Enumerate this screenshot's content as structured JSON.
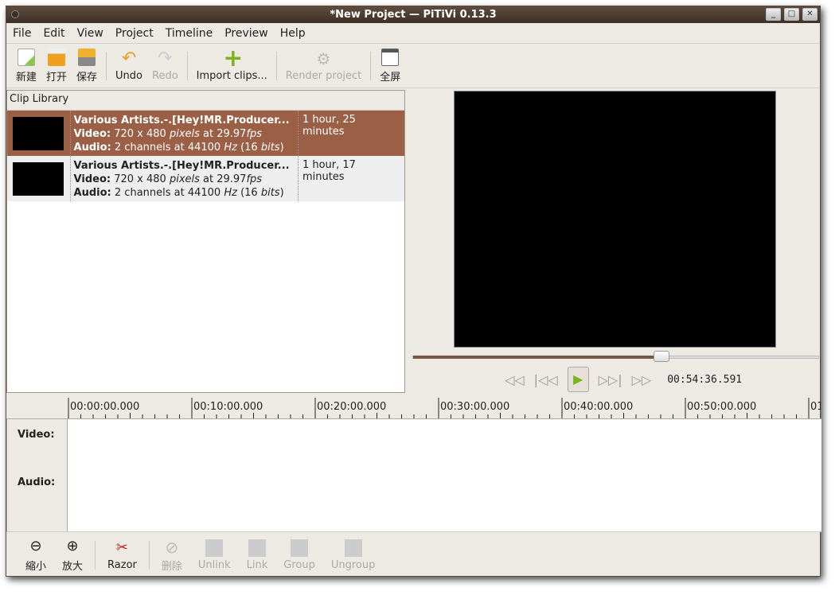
{
  "window": {
    "title": "*New Project — PiTiVi 0.13.3"
  },
  "menu": [
    "File",
    "Edit",
    "View",
    "Project",
    "Timeline",
    "Preview",
    "Help"
  ],
  "toolbar": {
    "new": "新建",
    "open": "打开",
    "save": "保存",
    "undo": "Undo",
    "redo": "Redo",
    "import": "Import clips...",
    "render": "Render project",
    "fullscreen": "全屏"
  },
  "library": {
    "title": "Clip Library",
    "clips": [
      {
        "name": "Various Artists.-.[Hey!MR.Producer...",
        "video_label": "Video:",
        "video": " 720 x 480 ",
        "pixels": "pixels",
        "at": " at 29.97",
        "fps": "fps",
        "audio_label": "Audio:",
        "audio": " 2 channels at 44100 ",
        "hz": "Hz",
        "bits_open": " (16 ",
        "bits": "bits",
        "bits_close": ")",
        "duration": "1 hour, 25 minutes"
      },
      {
        "name": "Various Artists.-.[Hey!MR.Producer...",
        "video_label": "Video:",
        "video": " 720 x 480 ",
        "pixels": "pixels",
        "at": " at 29.97",
        "fps": "fps",
        "audio_label": "Audio:",
        "audio": " 2 channels at 44100 ",
        "hz": "Hz",
        "bits_open": " (16 ",
        "bits": "bits",
        "bits_close": ")",
        "duration": "1 hour, 17 minutes"
      }
    ]
  },
  "viewer": {
    "time": "00:54:36.591",
    "position_fraction": 0.61
  },
  "ruler": [
    "00:00:00.000",
    "00:10:00.000",
    "00:20:00.000",
    "00:30:00.000",
    "00:40:00.000",
    "00:50:00.000",
    "01"
  ],
  "tracks": {
    "video": "Video:",
    "audio": "Audio:"
  },
  "bottombar": {
    "zoom_out": "縮小",
    "zoom_in": "放大",
    "razor": "Razor",
    "delete": "删除",
    "unlink": "Unlink",
    "link": "Link",
    "group": "Group",
    "ungroup": "Ungroup"
  },
  "colors": {
    "selection": "#9a5f45",
    "titlebar": "#4e3f34"
  }
}
